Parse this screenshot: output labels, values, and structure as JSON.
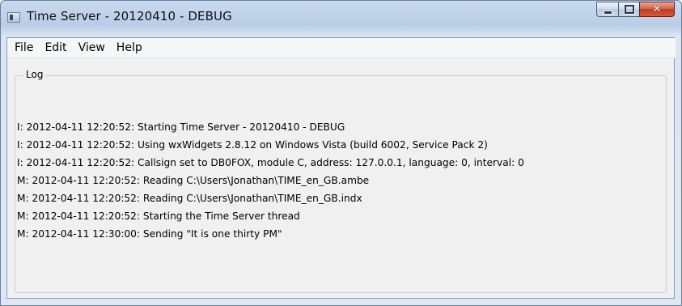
{
  "window": {
    "title": "Time Server - 20120410 - DEBUG",
    "buttons": {
      "minimize": "minimize-icon",
      "maximize": "maximize-icon",
      "close": "close-icon"
    }
  },
  "menu": [
    "File",
    "Edit",
    "View",
    "Help"
  ],
  "log": {
    "label": "Log",
    "lines": [
      "I: 2012-04-11 12:20:52: Starting Time Server - 20120410 - DEBUG",
      "I: 2012-04-11 12:20:52: Using wxWidgets 2.8.12 on Windows Vista (build 6002, Service Pack 2)",
      "I: 2012-04-11 12:20:52: Callsign set to DB0FOX, module C, address: 127.0.0.1, language: 0, interval: 0",
      "M: 2012-04-11 12:20:52: Reading C:\\Users\\Jonathan\\TIME_en_GB.ambe",
      "M: 2012-04-11 12:20:52: Reading C:\\Users\\Jonathan\\TIME_en_GB.indx",
      "M: 2012-04-11 12:20:52: Starting the Time Server thread",
      "M: 2012-04-11 12:30:00: Sending \"It is one thirty PM\""
    ]
  },
  "colors": {
    "titlebar": "#c9daee",
    "close_button": "#c03a20",
    "client_bg": "#f0f0f0"
  }
}
